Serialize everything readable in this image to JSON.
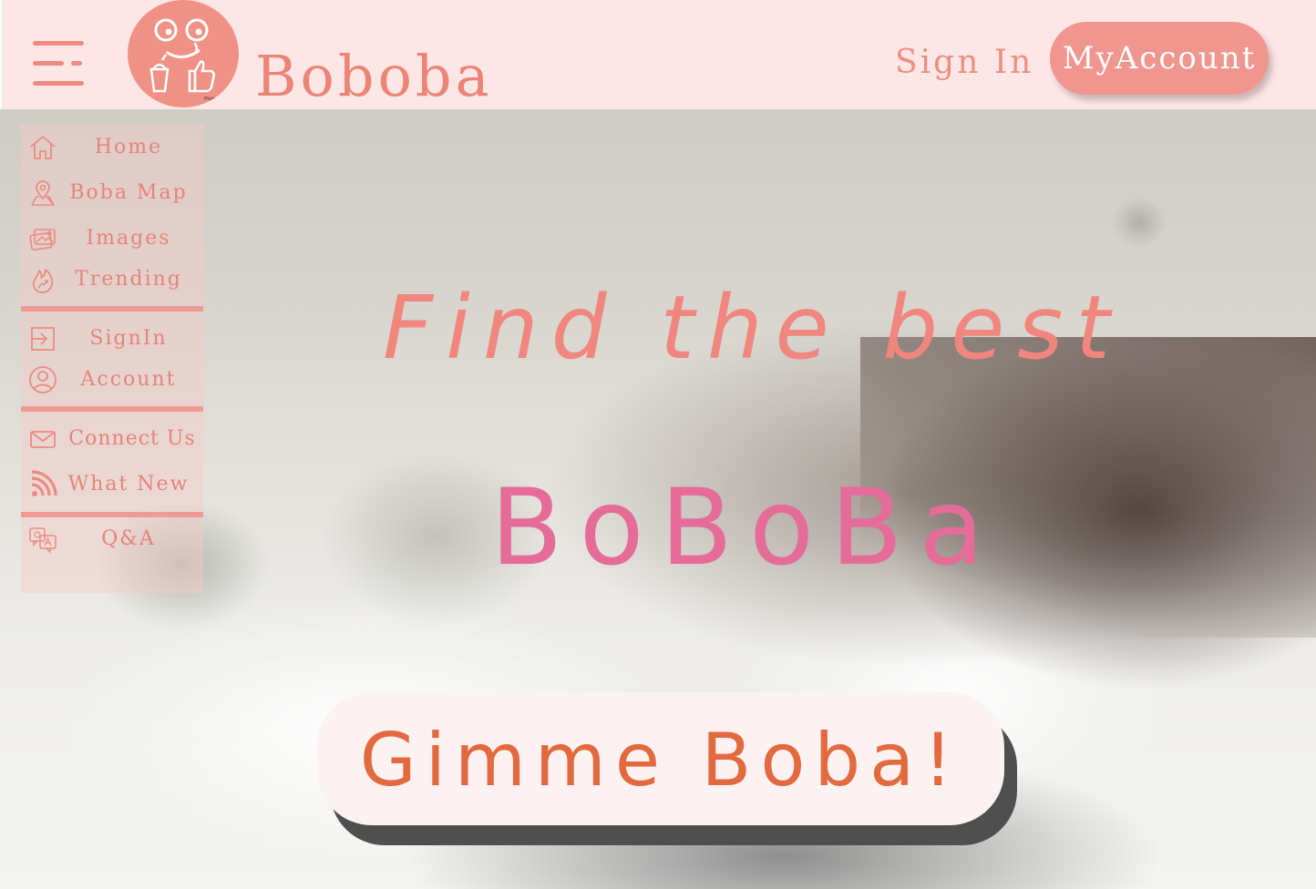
{
  "header": {
    "brand": "Boboba",
    "sign_in": "Sign In",
    "my_account": "MyAccount",
    "logo_watermark": "PhotoRoom"
  },
  "sidebar": {
    "items": [
      {
        "label": "Home",
        "icon": "home-icon"
      },
      {
        "label": "Boba Map",
        "icon": "map-pin-icon"
      },
      {
        "label": "Images",
        "icon": "images-icon"
      },
      {
        "label": "Trending",
        "icon": "trending-flame-icon"
      },
      {
        "label": "SignIn",
        "icon": "sign-in-icon"
      },
      {
        "label": "Account",
        "icon": "account-icon"
      },
      {
        "label": "Connect Us",
        "icon": "mail-icon"
      },
      {
        "label": "What New",
        "icon": "rss-icon"
      },
      {
        "label": "Q&A",
        "icon": "qa-icon"
      }
    ]
  },
  "hero": {
    "line1": "Find the best",
    "line2": "BoBoBa",
    "cta": "Gimme Boba!"
  },
  "colors": {
    "header_bg": "#fde6e6",
    "accent": "#ec8576",
    "button_pink": "#f0968f",
    "hero_pink": "#e56c98",
    "cta_orange": "#e3693f"
  }
}
